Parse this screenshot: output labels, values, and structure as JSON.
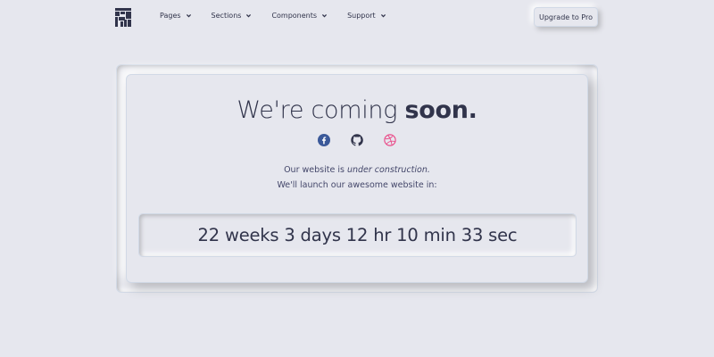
{
  "nav": {
    "items": [
      {
        "label": "Pages"
      },
      {
        "label": "Sections"
      },
      {
        "label": "Components"
      },
      {
        "label": "Support"
      }
    ],
    "cta_label": "Upgrade to Pro"
  },
  "hero": {
    "title_light": "We're coming",
    "title_bold": "soon.",
    "line1_prefix": "Our website is",
    "line1_emphasis": "under construction.",
    "line2": "We'll launch our awesome website in:",
    "countdown": "22 weeks 3 days 12 hr 10 min 33 sec"
  },
  "socials": [
    {
      "icon": "facebook-icon",
      "color": "#3b5999"
    },
    {
      "icon": "github-icon",
      "color": "#31344b"
    },
    {
      "icon": "dribbble-icon",
      "color": "#ea4c89"
    }
  ],
  "colors": {
    "background": "#e6e7ee",
    "text": "#31344b",
    "shadow_dark": "#b8b9be",
    "shadow_light": "#ffffff"
  }
}
